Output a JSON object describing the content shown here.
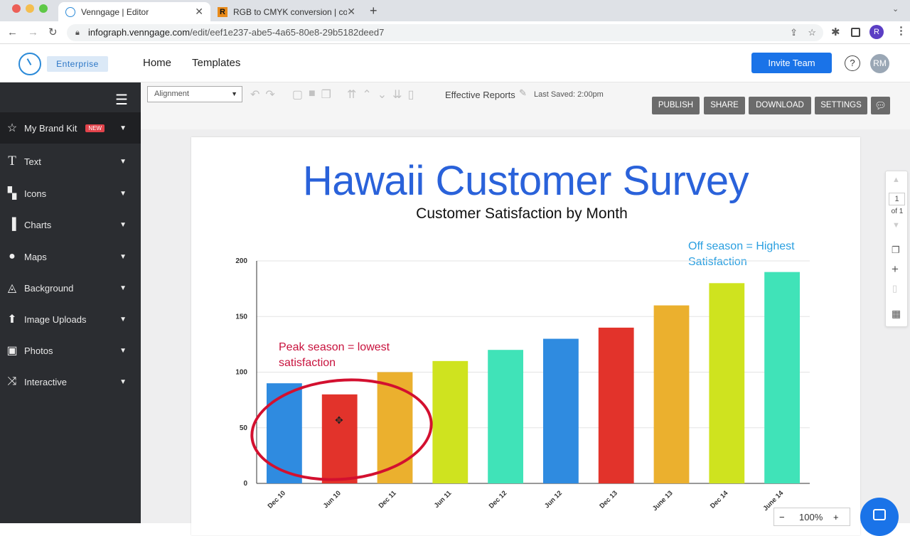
{
  "browser": {
    "tabs": [
      {
        "label": "Venngage | Editor",
        "close": "✕"
      },
      {
        "label": "RGB to CMYK conversion | colo",
        "close": "✕"
      }
    ],
    "new_tab": "+",
    "url_host": "infograph.venngage.com",
    "url_path": "/edit/eef1e237-abe5-4a65-80e8-29b5182deed7",
    "profile_initial": "R"
  },
  "app": {
    "plan_badge": "Enterprise",
    "nav": [
      "Home",
      "Templates"
    ],
    "invite_label": "Invite Team",
    "help": "?",
    "avatar": "RM"
  },
  "sidebar": {
    "items": [
      {
        "label": "My Brand Kit",
        "badge": "NEW",
        "icon": "star-icon"
      },
      {
        "label": "Text",
        "icon": "text-icon"
      },
      {
        "label": "Icons",
        "icon": "icons-icon"
      },
      {
        "label": "Charts",
        "icon": "chart-icon"
      },
      {
        "label": "Maps",
        "icon": "globe-icon"
      },
      {
        "label": "Background",
        "icon": "background-icon"
      },
      {
        "label": "Image Uploads",
        "icon": "upload-icon"
      },
      {
        "label": "Photos",
        "icon": "photo-icon"
      },
      {
        "label": "Interactive",
        "icon": "shuffle-icon"
      }
    ]
  },
  "toolbar": {
    "alignment": "Alignment",
    "doc_title": "Effective Reports",
    "last_saved": "Last Saved: 2:00pm",
    "buttons": [
      "PUBLISH",
      "SHARE",
      "DOWNLOAD",
      "SETTINGS"
    ]
  },
  "pager": {
    "page": "1",
    "of": "of 1"
  },
  "zoom": {
    "value": "100%",
    "minus": "−",
    "plus": "+"
  },
  "document": {
    "title": "Hawaii Customer Survey",
    "subtitle": "Customer Satisfaction by Month",
    "note_peak": [
      "Peak season = lowest",
      "satisfaction"
    ],
    "note_off": [
      "Off season = Highest",
      "Satisfaction"
    ]
  },
  "chart_data": {
    "type": "bar",
    "categories": [
      "Dec 10",
      "Jun 10",
      "Dec 11",
      "Jun 11",
      "Dec 12",
      "Jun 12",
      "Dec 13",
      "June 13",
      "Dec 14",
      "June 14"
    ],
    "values": [
      90,
      80,
      100,
      110,
      120,
      130,
      140,
      160,
      180,
      190
    ],
    "colors": [
      "#2f8be0",
      "#e2332b",
      "#ebb02e",
      "#cfe31f",
      "#40e3b8",
      "#2f8be0",
      "#e2332b",
      "#ebb02e",
      "#cfe31f",
      "#40e3b8"
    ],
    "yticks": [
      0,
      50,
      100,
      150,
      200
    ],
    "ylim": [
      0,
      200
    ],
    "grid": true
  }
}
